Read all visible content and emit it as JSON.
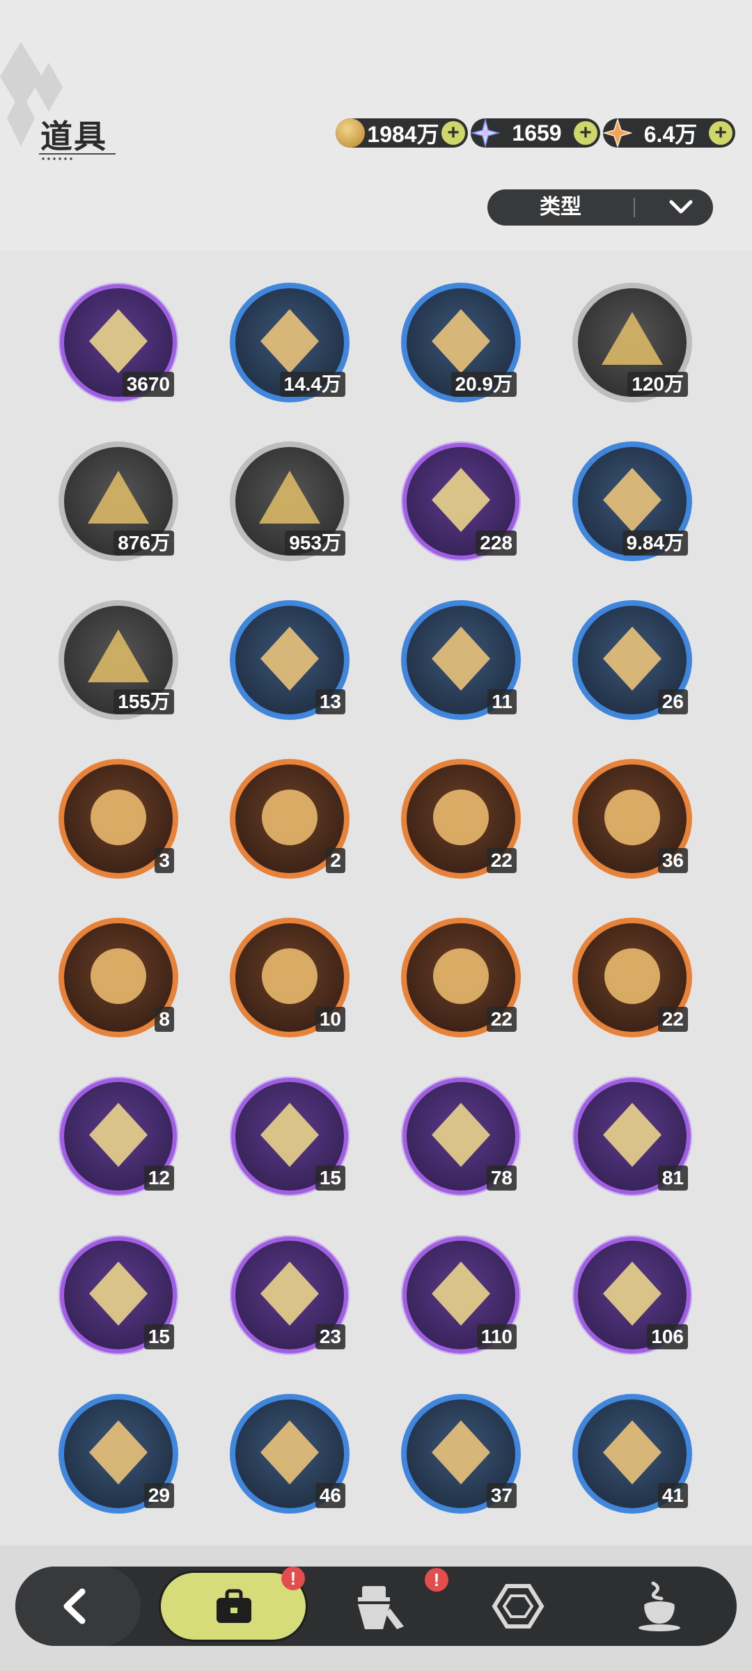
{
  "header": {
    "title": "道具",
    "currencies": [
      {
        "name": "gold-coin",
        "value": "1984万",
        "plus": "+"
      },
      {
        "name": "crystal",
        "value": "1659",
        "plus": "+"
      },
      {
        "name": "star-shard",
        "value": "6.4万",
        "plus": "+"
      }
    ],
    "type_filter": {
      "label": "类型"
    }
  },
  "items": [
    {
      "icon": "golden-crystal-icon",
      "rarity": "purple",
      "count": "3670"
    },
    {
      "icon": "gold-powder-icon",
      "rarity": "blue",
      "count": "14.4万"
    },
    {
      "icon": "red-crystal-icon",
      "rarity": "blue",
      "count": "20.9万"
    },
    {
      "icon": "gold-sand-icon",
      "rarity": "gray",
      "count": "120万"
    },
    {
      "icon": "dark-crystal-icon",
      "rarity": "gray",
      "count": "876万"
    },
    {
      "icon": "purple-orb-icon",
      "rarity": "gray",
      "count": "953万"
    },
    {
      "icon": "pink-paw-bag-icon",
      "rarity": "purple",
      "count": "228"
    },
    {
      "icon": "blue-paw-bag-icon",
      "rarity": "blue",
      "count": "9.84万"
    },
    {
      "icon": "brown-paw-bag-icon",
      "rarity": "gray",
      "count": "155万"
    },
    {
      "icon": "egg-icon",
      "rarity": "blue",
      "count": "13"
    },
    {
      "icon": "feather-bundle-icon",
      "rarity": "blue",
      "count": "11"
    },
    {
      "icon": "potion-vial-icon",
      "rarity": "blue",
      "count": "26"
    },
    {
      "icon": "pink-bouquet-icon",
      "rarity": "orange",
      "count": "3"
    },
    {
      "icon": "purple-bouquet-icon",
      "rarity": "orange",
      "count": "2"
    },
    {
      "icon": "pocket-watch-icon",
      "rarity": "orange",
      "count": "22"
    },
    {
      "icon": "green-potion-icon",
      "rarity": "orange",
      "count": "36"
    },
    {
      "icon": "crown-icon",
      "rarity": "orange",
      "count": "8"
    },
    {
      "icon": "diamond-box-icon",
      "rarity": "orange",
      "count": "10"
    },
    {
      "icon": "blue-book-icon",
      "rarity": "orange",
      "count": "22"
    },
    {
      "icon": "portrait-book-icon",
      "rarity": "orange",
      "count": "22"
    },
    {
      "icon": "cherry-bouquet-icon",
      "rarity": "purple",
      "count": "12"
    },
    {
      "icon": "lily-bouquet-icon",
      "rarity": "purple",
      "count": "15"
    },
    {
      "icon": "quill-ink-icon",
      "rarity": "purple",
      "count": "78"
    },
    {
      "icon": "pillow-icon",
      "rarity": "purple",
      "count": "81"
    },
    {
      "icon": "jade-pendant-icon",
      "rarity": "purple",
      "count": "15"
    },
    {
      "icon": "gold-ingot-icon",
      "rarity": "purple",
      "count": "23"
    },
    {
      "icon": "recipe-book-icon",
      "rarity": "purple",
      "count": "110"
    },
    {
      "icon": "fish-book-icon",
      "rarity": "purple",
      "count": "106"
    },
    {
      "icon": "iris-bouquet-icon",
      "rarity": "blue",
      "count": "29"
    },
    {
      "icon": "sunflower-bouquet-icon",
      "rarity": "blue",
      "count": "46"
    },
    {
      "icon": "towel-icon",
      "rarity": "blue",
      "count": "37"
    },
    {
      "icon": "teacup-icon",
      "rarity": "blue",
      "count": "41"
    }
  ],
  "nav": {
    "alert_mark": "!",
    "tabs": [
      "back-arrow-icon",
      "bag-icon",
      "outfit-icon",
      "gem-icon",
      "coffee-icon"
    ]
  },
  "colors": {
    "purple": "#9f5fe0",
    "blue": "#3f86dc",
    "gray": "#bdbdbd",
    "orange": "#e7823a",
    "accent": "#d6dc79",
    "alert": "#e34d4d"
  }
}
